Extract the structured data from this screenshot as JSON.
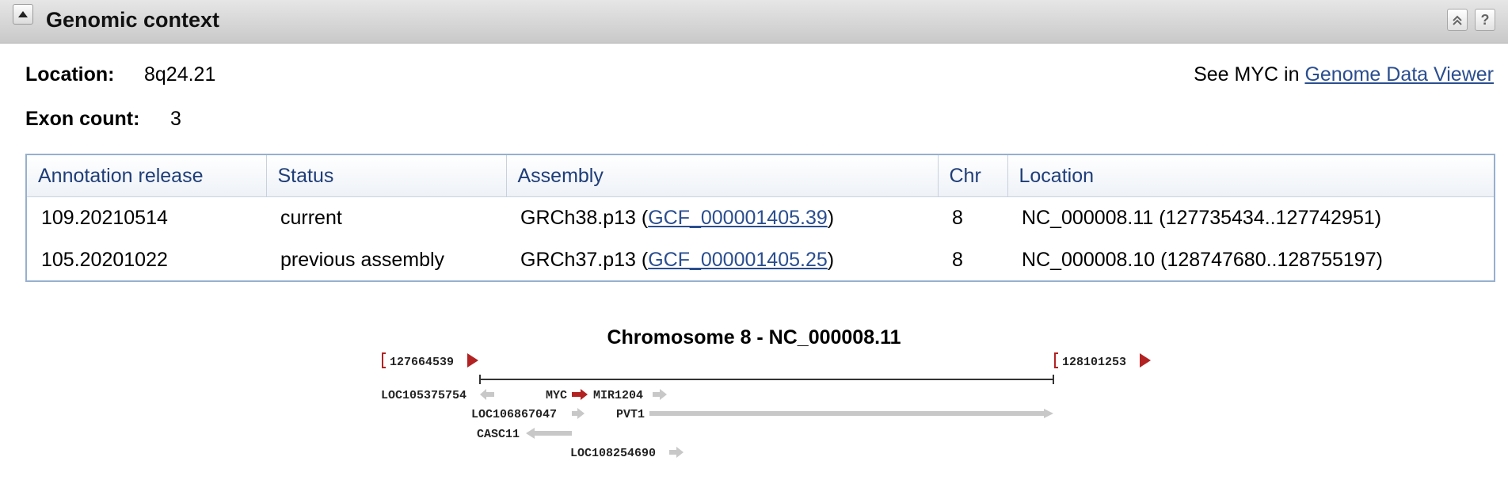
{
  "section": {
    "title": "Genomic context",
    "collapse_icon": "triangle-up-icon",
    "scroll_top_icon": "double-chevron-up-icon",
    "help_icon": "question-icon",
    "help_text": "?"
  },
  "location": {
    "label": "Location:",
    "value": "8q24.21"
  },
  "exon_count": {
    "label": "Exon count:",
    "value": "3"
  },
  "viewer": {
    "prefix": "See MYC in ",
    "link": "Genome Data Viewer"
  },
  "table": {
    "headers": [
      "Annotation release",
      "Status",
      "Assembly",
      "Chr",
      "Location"
    ],
    "rows": [
      {
        "release": "109.20210514",
        "status": "current",
        "assembly_prefix": "GRCh38.p13 (",
        "assembly_link": "GCF_000001405.39",
        "assembly_suffix": ")",
        "chr": "8",
        "location": "NC_000008.11 (127735434..127742951)"
      },
      {
        "release": "105.20201022",
        "status": "previous assembly",
        "assembly_prefix": "GRCh37.p13 (",
        "assembly_link": "GCF_000001405.25",
        "assembly_suffix": ")",
        "chr": "8",
        "location": "NC_000008.10 (128747680..128755197)"
      }
    ]
  },
  "diagram": {
    "title": "Chromosome 8 - NC_000008.11",
    "left_coord": "127664539",
    "right_coord": "128101253",
    "genes": [
      "LOC105375754",
      "MYC",
      "MIR1204",
      "LOC106867047",
      "PVT1",
      "CASC11",
      "LOC108254690"
    ],
    "colors": {
      "highlight": "#b22222",
      "gene_arrow": "#c8c8c8",
      "ruler": "#333333"
    }
  }
}
